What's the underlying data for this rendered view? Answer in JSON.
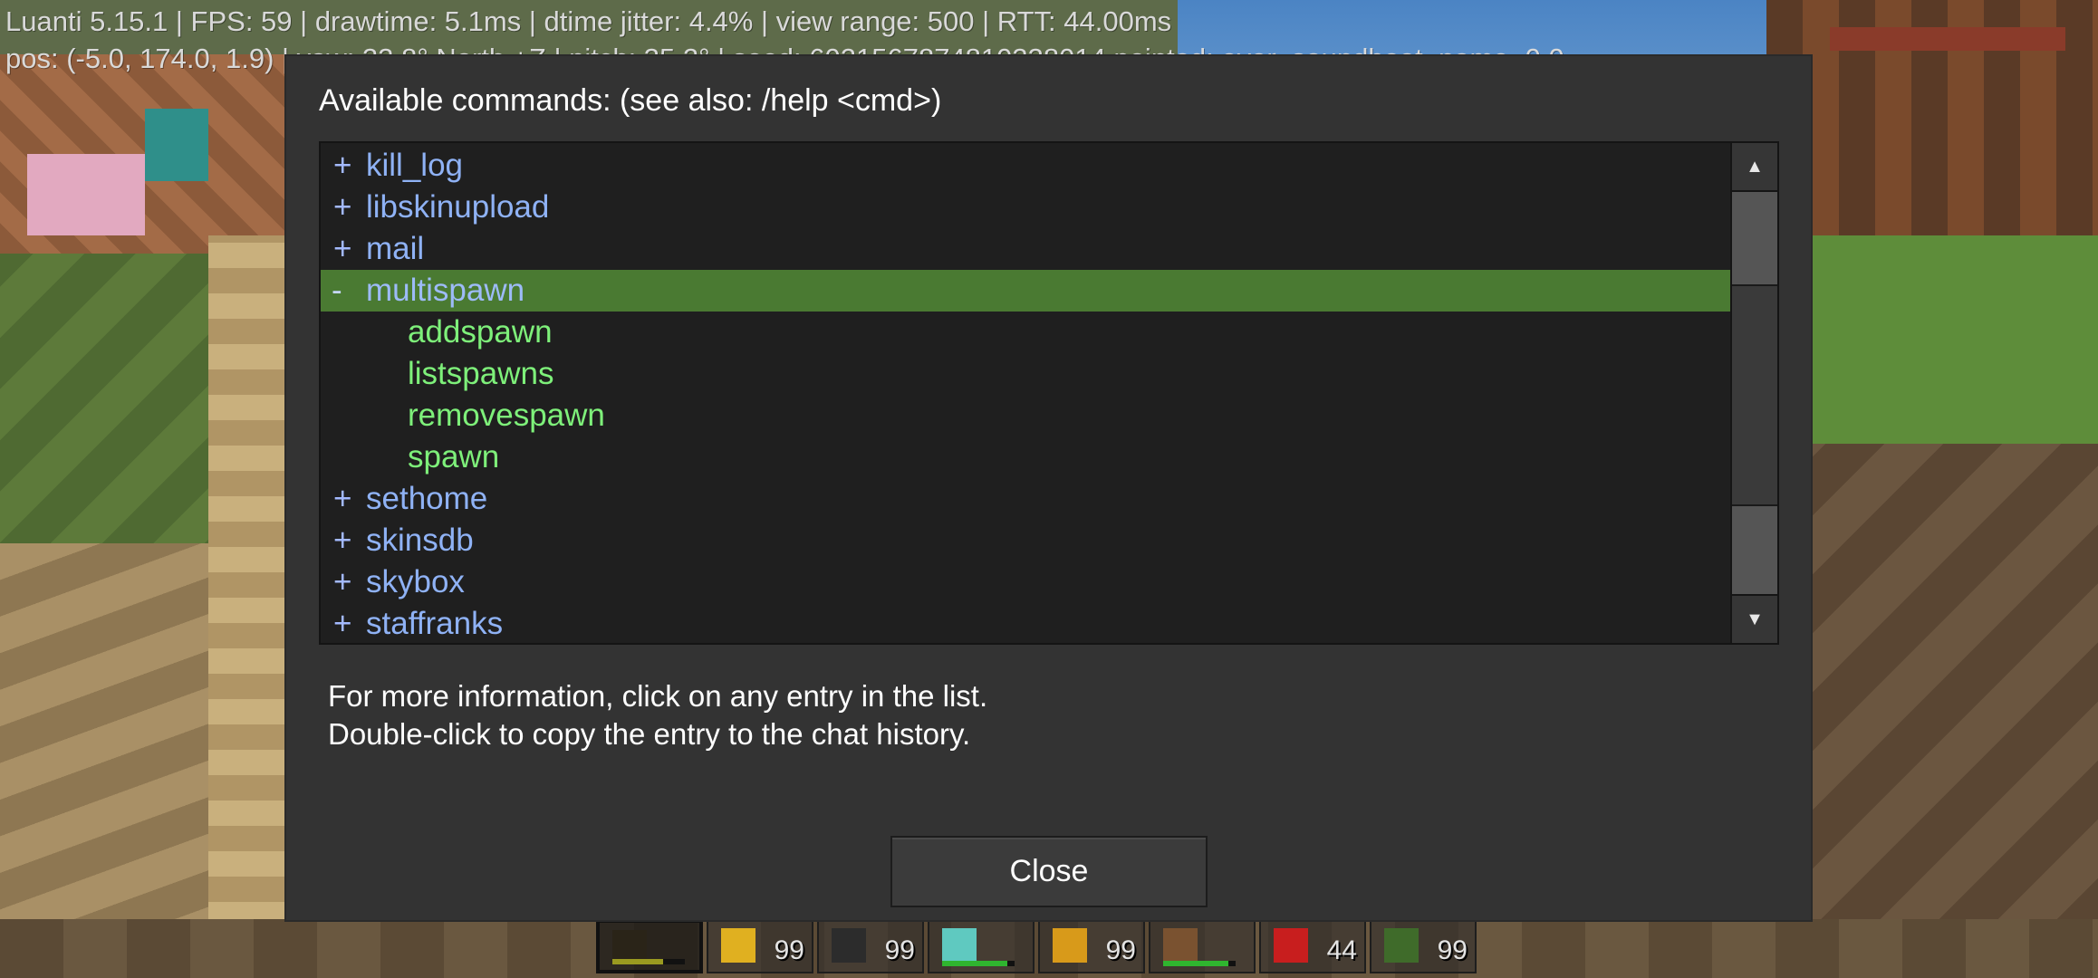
{
  "debug": {
    "line1": "Luanti 5.15.1 | FPS: 59 | drawtime: 5.1ms | dtime jitter: 4.4% | view range: 500 | RTT: 44.00ms",
    "line2": "pos: (-5.0, 174.0, 1.9) | yaw: 33.8° North +Z | pitch: 35.2° | seed: 6021567874810338014  pointed: ever_soundboat_name=0 0"
  },
  "dialog": {
    "title": "Available commands: (see also: /help <cmd>)",
    "rows": [
      {
        "mark": "+",
        "name": "kill_log"
      },
      {
        "mark": "+",
        "name": "libskinupload"
      },
      {
        "mark": "+",
        "name": "mail"
      },
      {
        "mark": "-",
        "name": "multispawn"
      },
      {
        "mark": "",
        "name": "addspawn"
      },
      {
        "mark": "",
        "name": "listspawns"
      },
      {
        "mark": "",
        "name": "removespawn"
      },
      {
        "mark": "",
        "name": "spawn"
      },
      {
        "mark": "+",
        "name": "sethome"
      },
      {
        "mark": "+",
        "name": "skinsdb"
      },
      {
        "mark": "+",
        "name": "skybox"
      },
      {
        "mark": "+",
        "name": "staffranks"
      }
    ],
    "selected_index": 3,
    "scroll_up_icon": "triangle-up",
    "scroll_down_icon": "triangle-down",
    "info_line1": "For more information, click on any entry in the list.",
    "info_line2": "Double-click to copy the entry to the chat history.",
    "close_label": "Close"
  },
  "hotbar": {
    "slots": [
      {
        "item": "dark-tool",
        "count": ""
      },
      {
        "item": "gold-block",
        "count": "99"
      },
      {
        "item": "dark-block",
        "count": "99"
      },
      {
        "item": "diamond-pick",
        "count": ""
      },
      {
        "item": "gold-ore",
        "count": "99"
      },
      {
        "item": "wood-stick",
        "count": ""
      },
      {
        "item": "red-apple",
        "count": "44"
      },
      {
        "item": "leaves",
        "count": "99"
      }
    ]
  },
  "colors": {
    "dialog_bg": "#333333",
    "list_bg": "#1f1f1f",
    "selected_row": "#4a7a32",
    "parent_text": "#8fb2f5",
    "child_text": "#7ef07a"
  }
}
